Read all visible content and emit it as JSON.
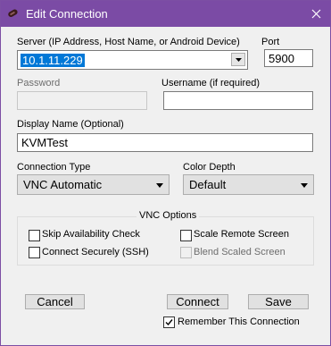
{
  "window": {
    "title": "Edit Connection",
    "app_icon": "remote-connection-icon",
    "close_icon": "close-icon",
    "accent_color": "#7b4ba5"
  },
  "server": {
    "label": "Server (IP Address, Host Name, or Android Device)",
    "value": "10.1.11.229"
  },
  "port": {
    "label": "Port",
    "value": "5900"
  },
  "password": {
    "label": "Password",
    "value": ""
  },
  "username": {
    "label": "Username (if required)",
    "value": ""
  },
  "display_name": {
    "label": "Display Name (Optional)",
    "value": "KVMTest"
  },
  "connection_type": {
    "label": "Connection Type",
    "value": "VNC Automatic"
  },
  "color_depth": {
    "label": "Color Depth",
    "value": "Default"
  },
  "vnc_options": {
    "title": "VNC Options",
    "skip_availability": {
      "label": "Skip Availability Check",
      "checked": false
    },
    "scale_remote": {
      "label": "Scale Remote Screen",
      "checked": false
    },
    "connect_securely": {
      "label": "Connect Securely (SSH)",
      "checked": false
    },
    "blend_scaled": {
      "label": "Blend Scaled Screen",
      "checked": false,
      "enabled": false
    }
  },
  "buttons": {
    "cancel": "Cancel",
    "connect": "Connect",
    "save": "Save"
  },
  "remember": {
    "label": "Remember This Connection",
    "checked": true
  }
}
